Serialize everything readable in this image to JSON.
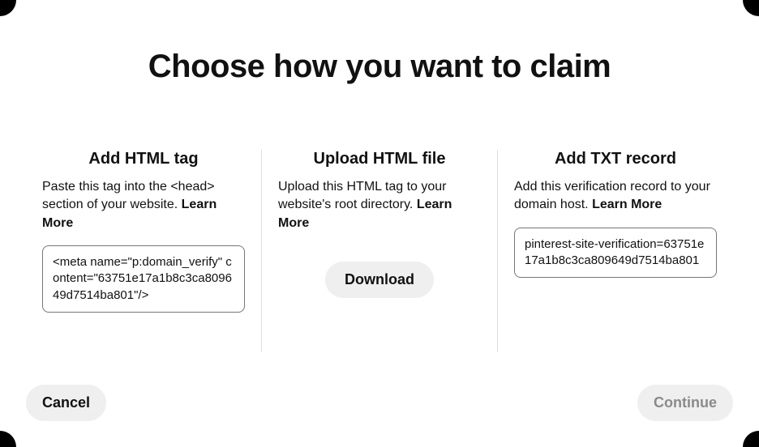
{
  "title": "Choose how you want to claim",
  "options": {
    "html_tag": {
      "title": "Add HTML tag",
      "description": "Paste this tag into the <head> section of your website.",
      "learn_more": "Learn More",
      "code": "<meta name=\"p:domain_verify\" content=\"63751e17a1b8c3ca809649d7514ba801\"/>"
    },
    "html_file": {
      "title": "Upload HTML file",
      "description": "Upload this HTML tag to your website's root directory.",
      "learn_more": "Learn More",
      "download_label": "Download"
    },
    "txt_record": {
      "title": "Add TXT record",
      "description": "Add this verification record to your domain host.",
      "learn_more": "Learn More",
      "code": "pinterest-site-verification=63751e17a1b8c3ca809649d7514ba801"
    }
  },
  "footer": {
    "cancel_label": "Cancel",
    "continue_label": "Continue"
  }
}
